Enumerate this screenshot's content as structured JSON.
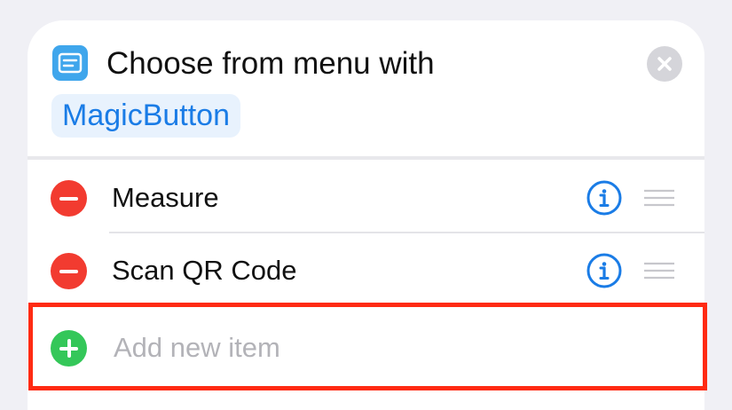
{
  "action": {
    "title": "Choose from menu with",
    "variable": "MagicButton",
    "icon": "menu-list-icon",
    "close_icon": "close-icon"
  },
  "menu_items": [
    {
      "label": "Measure",
      "remove_icon": "minus-circle-icon",
      "info_icon": "info-icon",
      "handle_icon": "drag-handle-icon"
    },
    {
      "label": "Scan QR Code",
      "remove_icon": "minus-circle-icon",
      "info_icon": "info-icon",
      "handle_icon": "drag-handle-icon"
    }
  ],
  "add_item": {
    "placeholder": "Add new item",
    "icon": "plus-circle-icon"
  },
  "colors": {
    "accent": "#1a7ce6",
    "remove": "#f23b30",
    "add": "#34c759",
    "highlight": "#ff2a12"
  }
}
